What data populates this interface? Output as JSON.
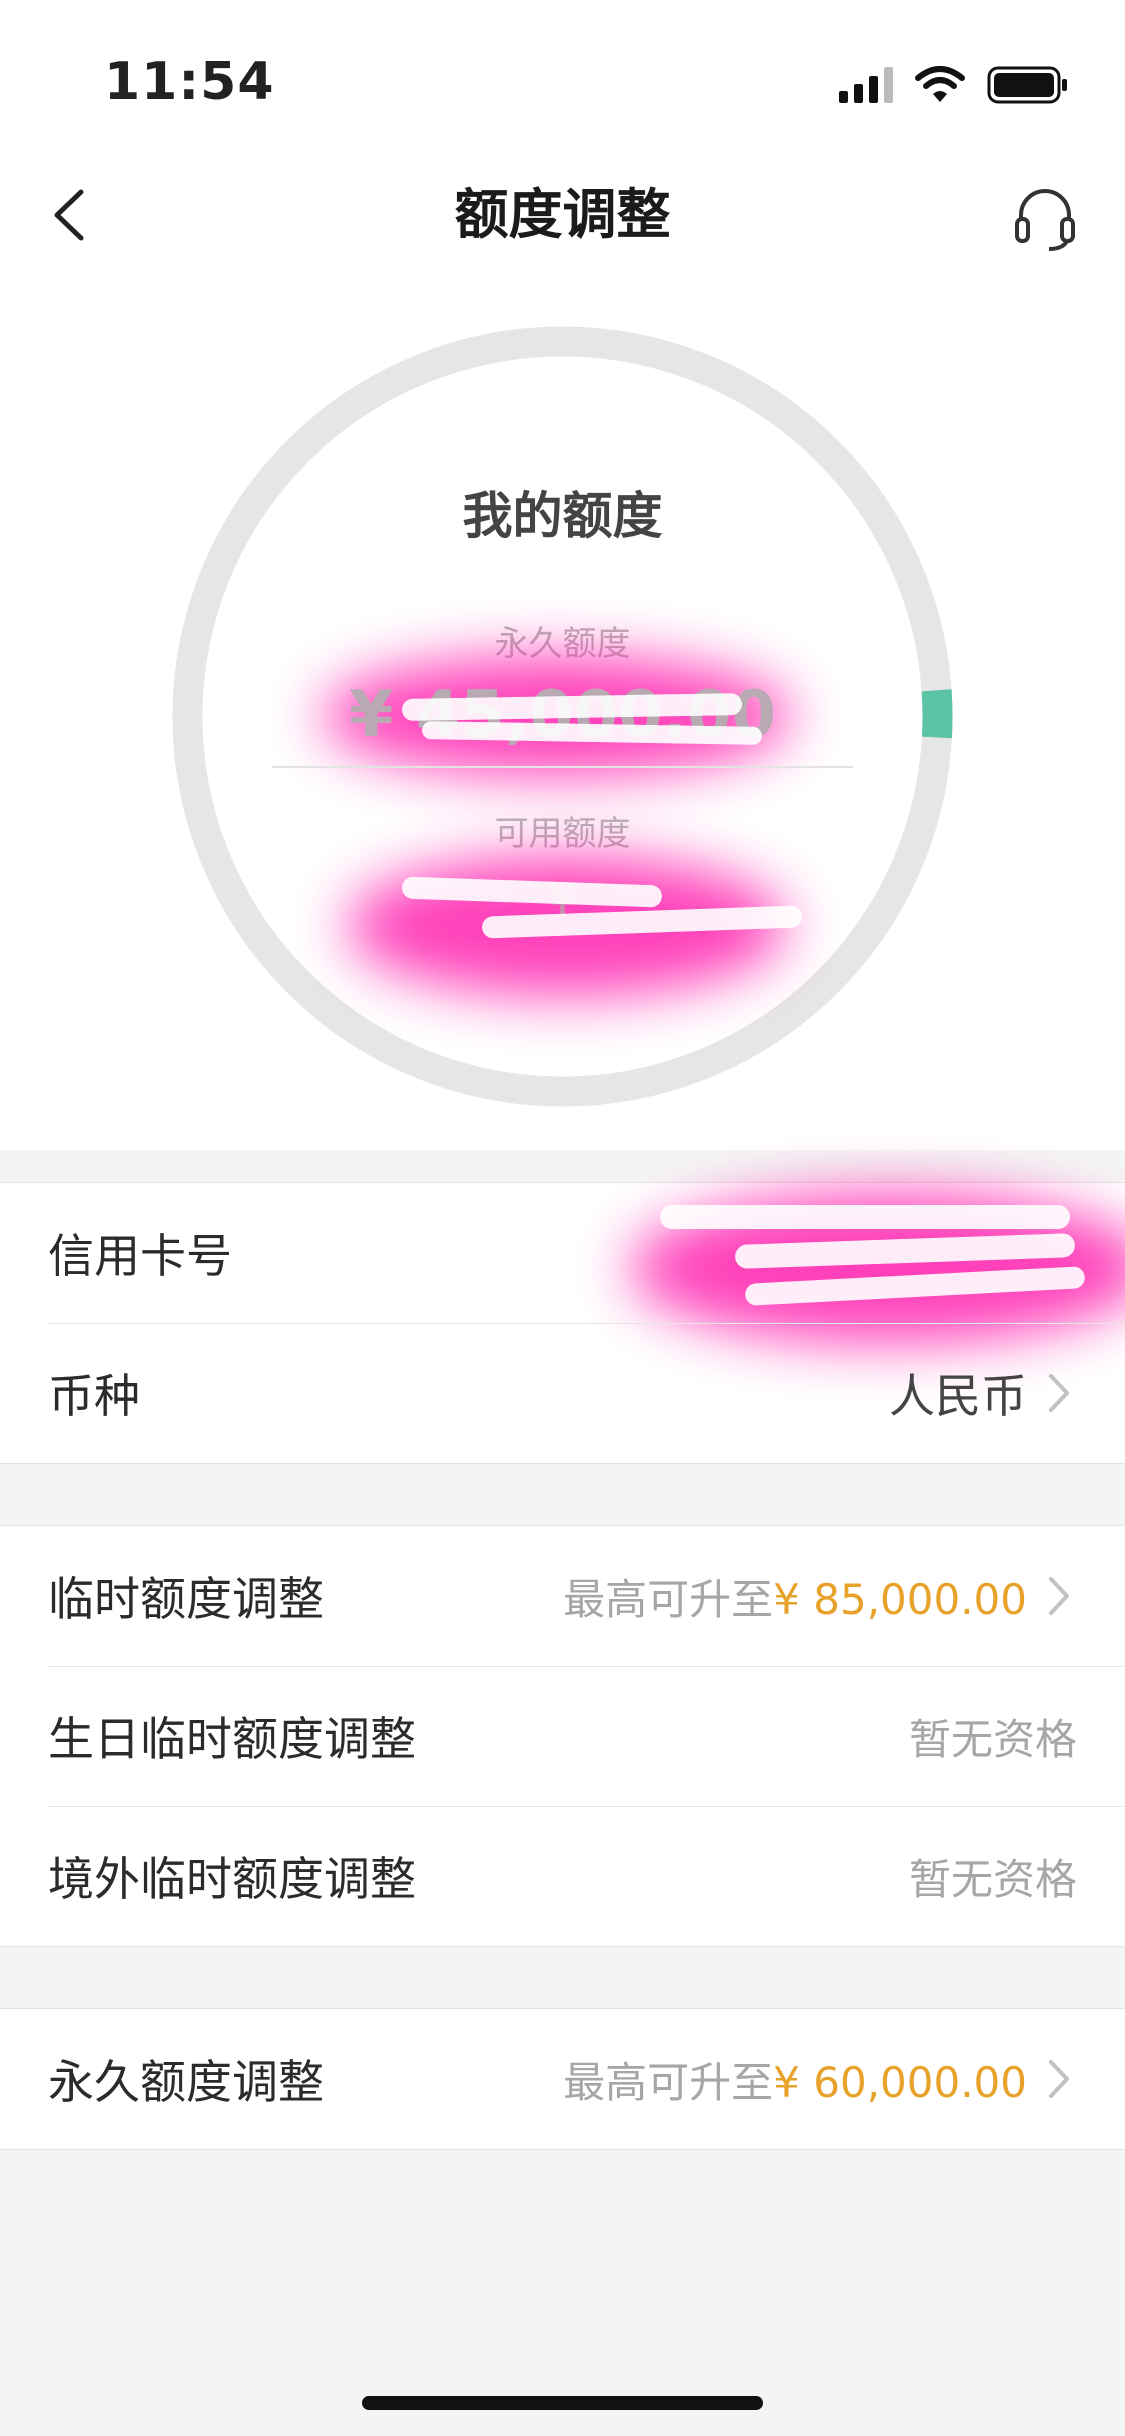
{
  "status_bar": {
    "time": "11:54"
  },
  "nav": {
    "title": "额度调整"
  },
  "limit_card": {
    "title": "我的额度",
    "permanent_label": "永久额度",
    "permanent_amount": "¥ 45,000.00",
    "available_label": "可用额度",
    "available_amount": "¥",
    "progress_fraction": 0.02
  },
  "card_info": {
    "card_number_label": "信用卡号",
    "currency_label": "币种",
    "currency_value": "人民币"
  },
  "temp_adjust": {
    "items": [
      {
        "label": "临时额度调整",
        "prefix": "最高可升至",
        "amount": "¥ 85,000.00"
      },
      {
        "label": "生日临时额度调整",
        "status": "暂无资格"
      },
      {
        "label": "境外临时额度调整",
        "status": "暂无资格"
      }
    ]
  },
  "permanent_adjust": {
    "label": "永久额度调整",
    "prefix": "最高可升至",
    "amount": "¥ 60,000.00"
  },
  "colors": {
    "accent": "#e7a22b",
    "progress": "#5cc3a4",
    "ring": "#e6e6e6"
  }
}
